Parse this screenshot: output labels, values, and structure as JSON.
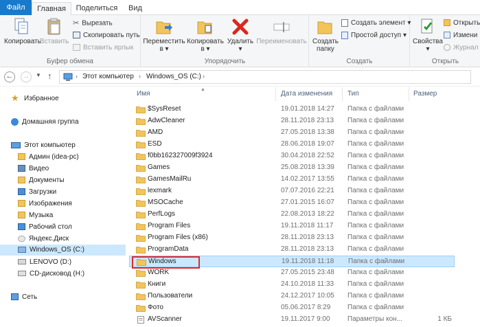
{
  "ribbon_tabs": {
    "file": "Файл",
    "home": "Главная",
    "share": "Поделиться",
    "view": "Вид"
  },
  "ribbon": {
    "clipboard": {
      "copy": "Копировать",
      "paste": "Вставить",
      "cut": "Вырезать",
      "copy_path": "Скопировать путь",
      "paste_shortcut": "Вставить ярлык",
      "label": "Буфер обмена"
    },
    "organize": {
      "move_line1": "Переместить",
      "move_line2": "в",
      "copy_line1": "Копировать",
      "copy_line2": "в",
      "delete": "Удалить",
      "rename": "Переименовать",
      "label": "Упорядочить"
    },
    "new": {
      "new_folder_line1": "Создать",
      "new_folder_line2": "папку",
      "new_item": "Создать элемент",
      "easy_access": "Простой доступ",
      "label": "Создать"
    },
    "open": {
      "properties": "Свойства",
      "open": "Открыть",
      "edit": "Измени",
      "history": "Журнал",
      "label": "Открыть"
    }
  },
  "address": {
    "crumb1": "Этот компьютер",
    "crumb2": "Windows_OS (C:)"
  },
  "sidebar": {
    "favorites": "Избранное",
    "homegroup": "Домашняя группа",
    "this_pc": "Этот компьютер",
    "items": [
      "Админ (idea-pc)",
      "Видео",
      "Документы",
      "Загрузки",
      "Изображения",
      "Музыка",
      "Рабочий стол",
      "Яндекс.Диск",
      "Windows_OS (C:)",
      "LENOVO (D:)",
      "CD-дисковод (H:)"
    ],
    "network": "Сеть"
  },
  "columns": {
    "name": "Имя",
    "date": "Дата изменения",
    "type": "Тип",
    "size": "Размер"
  },
  "files": [
    {
      "name": "$SysReset",
      "date": "19.01.2018 14:27",
      "type": "Папка с файлами",
      "size": ""
    },
    {
      "name": "AdwCleaner",
      "date": "28.11.2018 23:13",
      "type": "Папка с файлами",
      "size": ""
    },
    {
      "name": "AMD",
      "date": "27.05.2018 13:38",
      "type": "Папка с файлами",
      "size": ""
    },
    {
      "name": "ESD",
      "date": "28.06.2018 19:07",
      "type": "Папка с файлами",
      "size": ""
    },
    {
      "name": "f0bb162327009f3924",
      "date": "30.04.2018 22:52",
      "type": "Папка с файлами",
      "size": ""
    },
    {
      "name": "Games",
      "date": "25.08.2018 13:39",
      "type": "Папка с файлами",
      "size": ""
    },
    {
      "name": "GamesMailRu",
      "date": "14.02.2017 13:55",
      "type": "Папка с файлами",
      "size": ""
    },
    {
      "name": "lexmark",
      "date": "07.07.2016 22:21",
      "type": "Папка с файлами",
      "size": ""
    },
    {
      "name": "MSOCache",
      "date": "27.01.2015 16:07",
      "type": "Папка с файлами",
      "size": ""
    },
    {
      "name": "PerfLogs",
      "date": "22.08.2013 18:22",
      "type": "Папка с файлами",
      "size": ""
    },
    {
      "name": "Program Files",
      "date": "19.11.2018 11:17",
      "type": "Папка с файлами",
      "size": ""
    },
    {
      "name": "Program Files (x86)",
      "date": "28.11.2018 23:13",
      "type": "Папка с файлами",
      "size": ""
    },
    {
      "name": "ProgramData",
      "date": "28.11.2018 23:13",
      "type": "Папка с файлами",
      "size": ""
    },
    {
      "name": "Windows",
      "date": "19.11.2018 11:18",
      "type": "Папка с файлами",
      "size": ""
    },
    {
      "name": "WORK",
      "date": "27.05.2015 23:48",
      "type": "Папка с файлами",
      "size": ""
    },
    {
      "name": "Книги",
      "date": "24.10.2018 11:33",
      "type": "Папка с файлами",
      "size": ""
    },
    {
      "name": "Пользователи",
      "date": "24.12.2017 10:05",
      "type": "Папка с файлами",
      "size": ""
    },
    {
      "name": "Фото",
      "date": "05.06.2017 8:29",
      "type": "Папка с файлами",
      "size": ""
    },
    {
      "name": "AVScanner",
      "date": "19.11.2017 9:00",
      "type": "Параметры кон...",
      "size": "1 КБ"
    }
  ],
  "highlight": {
    "file_name": "Windows"
  },
  "colors": {
    "file_tab": "#1979ca",
    "selection": "#cce8ff",
    "annotation": "#e0262f",
    "folder": "#f2c55c"
  }
}
